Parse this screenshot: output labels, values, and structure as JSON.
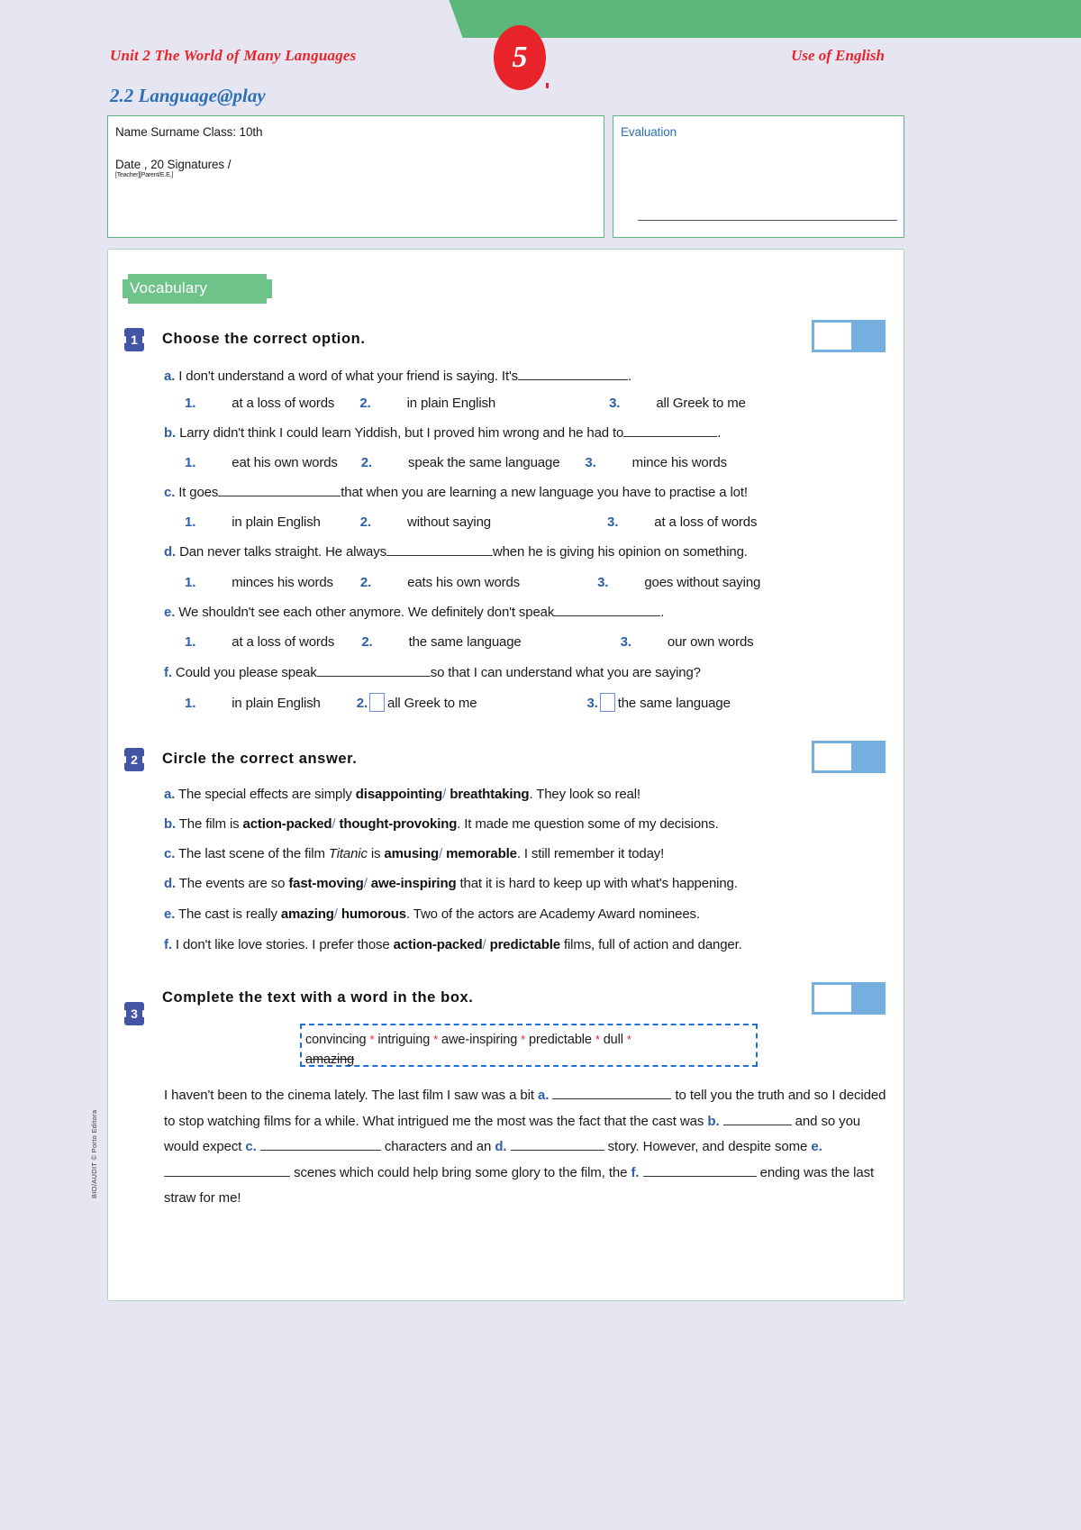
{
  "header": {
    "page_number": "5",
    "unit": "Unit 2 The World of Many Languages",
    "section": "Use of English",
    "subtitle": "2.2 Language@play"
  },
  "identity": {
    "line1": "Name Surname Class: 10th",
    "line2": "Date , 20   Signatures /",
    "line3": "[Teacher][Parent/E.E.]"
  },
  "evaluation": {
    "label": "Evaluation"
  },
  "vocabulary_tag": "Vocabulary",
  "exercise1": {
    "number": "1",
    "title": "Choose the correct option.",
    "score_slash": "/",
    "items": [
      {
        "label": "a.",
        "text_before": "I don't understand a word of what your friend is saying. It's",
        "text_after": ".",
        "options": [
          "at a loss of words",
          "in plain English",
          "all Greek to me"
        ]
      },
      {
        "label": "b.",
        "text_before": "Larry didn't think I could learn Yiddish, but I proved him wrong and he had to",
        "text_after": ".",
        "options": [
          "eat his own words",
          "speak the same language",
          "mince his words"
        ]
      },
      {
        "label": "c.",
        "text_before": "It goes",
        "text_after": "that when you are learning a new language you have to practise a lot!",
        "options": [
          "in plain English",
          "without saying",
          "at a loss of words"
        ]
      },
      {
        "label": "d.",
        "text_before": "Dan never talks straight. He always",
        "text_after": "when he is giving his opinion on something.",
        "options": [
          "minces his words",
          "eats his own words",
          "goes without saying"
        ]
      },
      {
        "label": "e.",
        "text_before": "We shouldn't see each other anymore. We definitely don't speak",
        "text_after": ".",
        "options": [
          "at a loss of words",
          "the same language",
          "our own words"
        ]
      },
      {
        "label": "f.",
        "text_before": "Could you please speak",
        "text_after": "so that I can understand what you are saying?",
        "options": [
          "in plain English",
          "all Greek to me",
          "the same language"
        ],
        "has_checkboxes": true
      }
    ],
    "option_numbers": [
      "1.",
      "2.",
      "3."
    ]
  },
  "exercise2": {
    "number": "2",
    "title": "Circle the correct answer.",
    "score_slash": "/",
    "items": [
      {
        "label": "a.",
        "pre": "The special effects are simply ",
        "choice1": "disappointing",
        "choice2": "breathtaking",
        "post": ". They look so real!"
      },
      {
        "label": "b.",
        "pre": "The film is ",
        "choice1": "action-packed",
        "choice2": "thought-provoking",
        "post": ". It made me question some of my decisions."
      },
      {
        "label": "c.",
        "pre": "The last scene of the film ",
        "italic": "Titanic",
        "pre2": " is ",
        "choice1": "amusing",
        "choice2": "memorable",
        "post": ". I still remember it today!"
      },
      {
        "label": "d.",
        "pre": "The events are so ",
        "choice1": "fast-moving",
        "choice2": "awe-inspiring",
        "post": " that it is hard to keep up with what's happening."
      },
      {
        "label": "e.",
        "pre": "The cast is really ",
        "choice1": "amazing",
        "choice2": "humorous",
        "post": ". Two of the actors are Academy Award nominees."
      },
      {
        "label": "f.",
        "pre": "I don't like love stories. I prefer those ",
        "choice1": "action-packed",
        "choice2": "predictable",
        "post": " films, full of action and danger."
      }
    ],
    "separator": "/"
  },
  "exercise3": {
    "number": "3",
    "title": "Complete the text with a word in the box.",
    "score_slash": "/",
    "wordbox": {
      "line1_words": [
        "convincing",
        "intriguing",
        "awe-inspiring",
        "predictable",
        "dull"
      ],
      "line2_word": "amazing",
      "separator": "*"
    },
    "paragraph": {
      "p1": "I haven't been to the cinema lately. The last film I saw was a bit ",
      "a_label": "a.",
      "p2": " to tell you the truth and so I decided to stop watching films for a while. What intrigued me the most was the fact that the cast was ",
      "b_label": "b.",
      "p3": " and so you would expect ",
      "c_label": "c.",
      "p4": " characters and an ",
      "d_label": "d.",
      "p5": " story. However, and despite some ",
      "e_label": "e.",
      "p6": " scenes which could help bring some glory to the film, the ",
      "f_label": "f.",
      "p7": " ending was the last straw for me!"
    }
  },
  "side_credit": "BIO/AUDIT © Porto Editora"
}
